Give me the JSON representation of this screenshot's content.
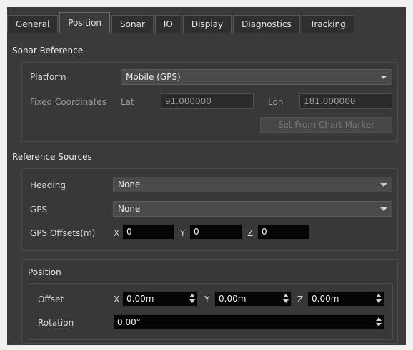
{
  "tabs": [
    "General",
    "Position",
    "Sonar",
    "IO",
    "Display",
    "Diagnostics",
    "Tracking"
  ],
  "sonar_reference": {
    "title": "Sonar Reference",
    "platform_label": "Platform",
    "platform_value": "Mobile (GPS)",
    "fixed_coords_label": "Fixed Coordinates",
    "lat_label": "Lat",
    "lat_value": "91.000000",
    "lon_label": "Lon",
    "lon_value": "181.000000",
    "set_button": "Set From Chart Marker"
  },
  "reference_sources": {
    "title": "Reference Sources",
    "heading_label": "Heading",
    "heading_value": "None",
    "gps_label": "GPS",
    "gps_value": "None",
    "offsets_label": "GPS Offsets(m)",
    "x_label": "X",
    "x_value": "0",
    "y_label": "Y",
    "y_value": "0",
    "z_label": "Z",
    "z_value": "0"
  },
  "position": {
    "title": "Position",
    "offset_label": "Offset",
    "x_label": "X",
    "x_value": "0.00m",
    "y_label": "Y",
    "y_value": "0.00m",
    "z_label": "Z",
    "z_value": "0.00m",
    "rotation_label": "Rotation",
    "rotation_value": "0.00°"
  }
}
